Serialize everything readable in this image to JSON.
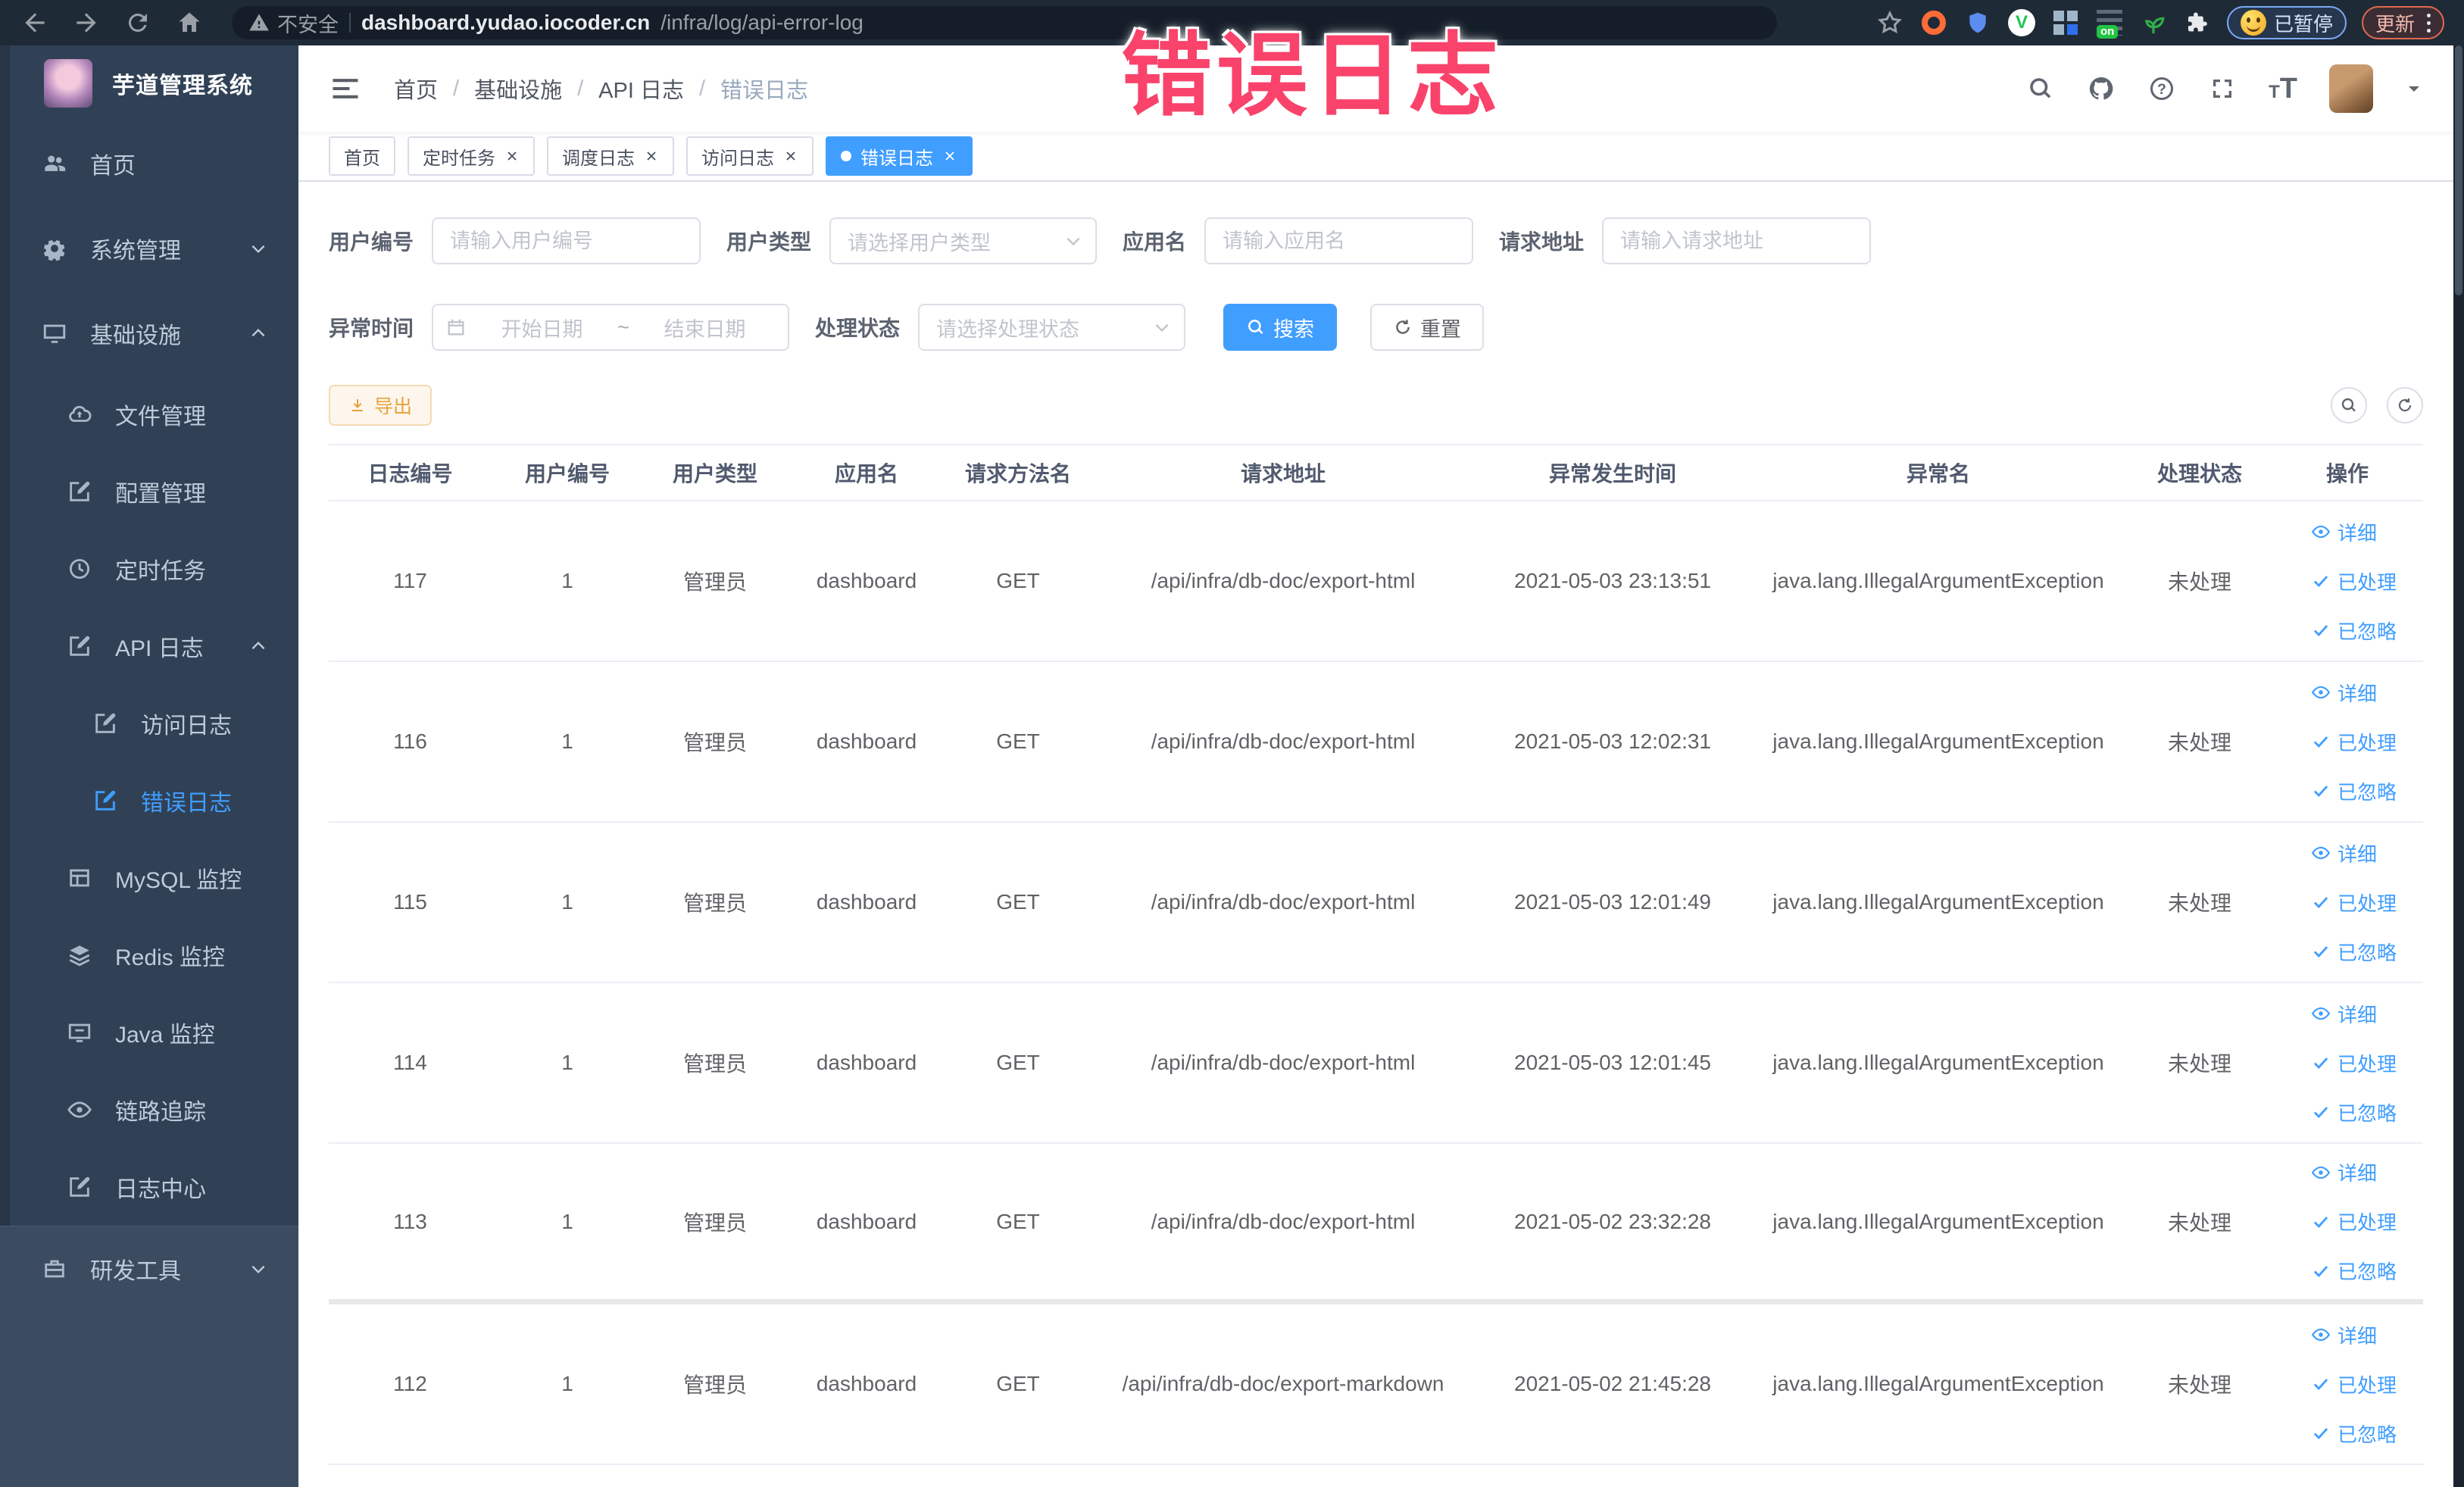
{
  "browser": {
    "security_label": "不安全",
    "url_host": "dashboard.yudao.iocoder.cn",
    "url_path": "/infra/log/api-error-log",
    "paused_badge": "已暂停",
    "update_badge": "更新"
  },
  "overlay_title": "错误日志",
  "sidebar": {
    "app_title": "芋道管理系统",
    "items": [
      {
        "label": "首页",
        "icon": "home-icon",
        "depth": 0
      },
      {
        "label": "系统管理",
        "icon": "gear-icon",
        "depth": 0,
        "chevron": "down"
      },
      {
        "label": "基础设施",
        "icon": "infrastructure-icon",
        "depth": 0,
        "chevron": "up"
      },
      {
        "label": "文件管理",
        "icon": "file-manage-icon",
        "depth": 1
      },
      {
        "label": "配置管理",
        "icon": "config-manage-icon",
        "depth": 1
      },
      {
        "label": "定时任务",
        "icon": "scheduled-task-icon",
        "depth": 1
      },
      {
        "label": "API 日志",
        "icon": "api-log-icon",
        "depth": 1,
        "chevron": "up"
      },
      {
        "label": "访问日志",
        "icon": "access-log-icon",
        "depth": 2
      },
      {
        "label": "错误日志",
        "icon": "error-log-icon",
        "depth": 2,
        "active": true
      },
      {
        "label": "MySQL 监控",
        "icon": "mysql-monitor-icon",
        "depth": 1
      },
      {
        "label": "Redis 监控",
        "icon": "redis-monitor-icon",
        "depth": 1
      },
      {
        "label": "Java 监控",
        "icon": "java-monitor-icon",
        "depth": 1
      },
      {
        "label": "链路追踪",
        "icon": "trace-icon",
        "depth": 1
      },
      {
        "label": "日志中心",
        "icon": "log-center-icon",
        "depth": 1
      },
      {
        "label": "研发工具",
        "icon": "dev-tools-icon",
        "depth": 0,
        "chevron": "down",
        "section": "bottom"
      }
    ]
  },
  "header": {
    "breadcrumb": [
      "首页",
      "基础设施",
      "API 日志",
      "错误日志"
    ],
    "breadcrumb_separator": "/",
    "icons": [
      "search-icon",
      "github-icon",
      "help-icon",
      "fullscreen-icon",
      "font-size-icon",
      "user-avatar",
      "caret-down-icon"
    ]
  },
  "tags": [
    {
      "label": "首页",
      "closable": false,
      "active": false
    },
    {
      "label": "定时任务",
      "closable": true,
      "active": false
    },
    {
      "label": "调度日志",
      "closable": true,
      "active": false
    },
    {
      "label": "访问日志",
      "closable": true,
      "active": false
    },
    {
      "label": "错误日志",
      "closable": true,
      "active": true
    }
  ],
  "filters": {
    "user_id": {
      "label": "用户编号",
      "placeholder": "请输入用户编号"
    },
    "user_type": {
      "label": "用户类型",
      "placeholder": "请选择用户类型"
    },
    "app_name": {
      "label": "应用名",
      "placeholder": "请输入应用名"
    },
    "request_url": {
      "label": "请求地址",
      "placeholder": "请输入请求地址"
    },
    "exception_time": {
      "label": "异常时间",
      "start_placeholder": "开始日期",
      "separator": "~",
      "end_placeholder": "结束日期"
    },
    "process_status": {
      "label": "处理状态",
      "placeholder": "请选择处理状态"
    },
    "search_label": "搜索",
    "reset_label": "重置"
  },
  "toolbar": {
    "export_label": "导出"
  },
  "table": {
    "columns": [
      "日志编号",
      "用户编号",
      "用户类型",
      "应用名",
      "请求方法名",
      "请求地址",
      "异常发生时间",
      "异常名",
      "处理状态",
      "操作"
    ],
    "actions": {
      "detail": "详细",
      "processed": "已处理",
      "ignored": "已忽略"
    },
    "rows": [
      {
        "id": "117",
        "user_id": "1",
        "user_type": "管理员",
        "app": "dashboard",
        "method": "GET",
        "url": "/api/infra/db-doc/export-html",
        "time": "2021-05-03 23:13:51",
        "exception": "java.lang.IllegalArgumentException",
        "status": "未处理"
      },
      {
        "id": "116",
        "user_id": "1",
        "user_type": "管理员",
        "app": "dashboard",
        "method": "GET",
        "url": "/api/infra/db-doc/export-html",
        "time": "2021-05-03 12:02:31",
        "exception": "java.lang.IllegalArgumentException",
        "status": "未处理"
      },
      {
        "id": "115",
        "user_id": "1",
        "user_type": "管理员",
        "app": "dashboard",
        "method": "GET",
        "url": "/api/infra/db-doc/export-html",
        "time": "2021-05-03 12:01:49",
        "exception": "java.lang.IllegalArgumentException",
        "status": "未处理"
      },
      {
        "id": "114",
        "user_id": "1",
        "user_type": "管理员",
        "app": "dashboard",
        "method": "GET",
        "url": "/api/infra/db-doc/export-html",
        "time": "2021-05-03 12:01:45",
        "exception": "java.lang.IllegalArgumentException",
        "status": "未处理"
      },
      {
        "id": "113",
        "user_id": "1",
        "user_type": "管理员",
        "app": "dashboard",
        "method": "GET",
        "url": "/api/infra/db-doc/export-html",
        "time": "2021-05-02 23:32:28",
        "exception": "java.lang.IllegalArgumentException",
        "status": "未处理"
      },
      {
        "id": "112",
        "user_id": "1",
        "user_type": "管理员",
        "app": "dashboard",
        "method": "GET",
        "url": "/api/infra/db-doc/export-markdown",
        "time": "2021-05-02 21:45:28",
        "exception": "java.lang.IllegalArgumentException",
        "status": "未处理"
      }
    ]
  },
  "colors": {
    "primary": "#409EFF",
    "warning": "#E6A23C",
    "annotation_pink": "#F9436B",
    "sidebar_bg": "#304156",
    "browser_bar_bg": "#1F2A37"
  }
}
